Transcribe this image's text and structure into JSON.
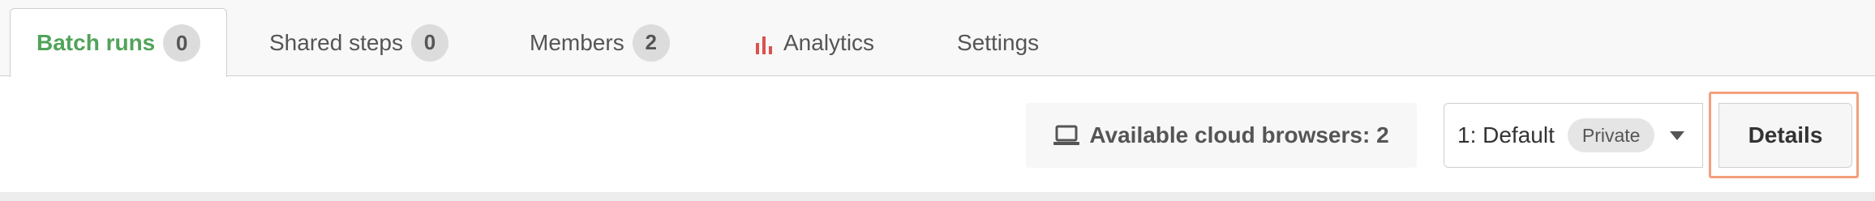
{
  "tabs": {
    "batch_runs": {
      "label": "Batch runs",
      "count": "0"
    },
    "shared_steps": {
      "label": "Shared steps",
      "count": "0"
    },
    "members": {
      "label": "Members",
      "count": "2"
    },
    "analytics": {
      "label": "Analytics",
      "icon": "bar-chart-icon"
    },
    "settings": {
      "label": "Settings"
    }
  },
  "toolbar": {
    "browsers_label": "Available cloud browsers: 2",
    "browsers_icon": "laptop-icon",
    "environment_value": "1: Default",
    "environment_badge": "Private",
    "details_label": "Details"
  },
  "colors": {
    "active_tab": "#52a35a",
    "analytics_icon": "#d9534f",
    "highlight_outline": "#f2a07b"
  }
}
